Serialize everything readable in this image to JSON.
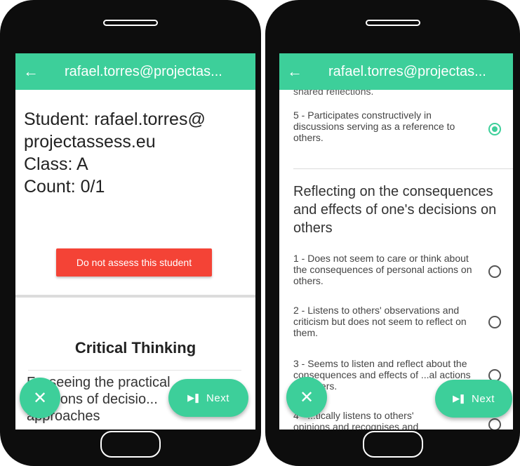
{
  "left_screen": {
    "appbar_title": "rafael.torres@projectas...",
    "student_line1": "Student: rafael.torres@",
    "student_line2": "projectassess.eu",
    "class_label": "Class: A",
    "count_label": "Count: 0/1",
    "skip_button": "Do not assess this student",
    "section_title": "Critical Thinking",
    "criterion_line1": "F... seeing the practical",
    "criterion_line2": "...cations of decisio...",
    "criterion_line3": "approaches",
    "next_label": "Next"
  },
  "right_screen": {
    "appbar_title": "rafael.torres@projectas...",
    "cut_text": "shared reflections.",
    "option_5": "5 - Participates constructively in discussions serving as a reference to others.",
    "criterion_title": "Reflecting on the consequences and effects of one's decisions on others",
    "option_1": "1 - Does not seem to care or think about the consequences of personal actions on others.",
    "option_2": "2 - Listens to others' observations and criticism but does not seem to reflect on them.",
    "option_3": "3 - Seems to listen and reflect about the consequences and effects of ...al actions on others.",
    "option_4_line1": "4 - ...tically listens to others'",
    "option_4_line2": "opinions and recognises and",
    "next_label": "Next",
    "selected_option": 5
  },
  "colors": {
    "accent": "#3dcf9a",
    "danger": "#f44336"
  },
  "icons": [
    "back-arrow-icon",
    "close-icon",
    "skip-next-icon",
    "radio-icon"
  ]
}
